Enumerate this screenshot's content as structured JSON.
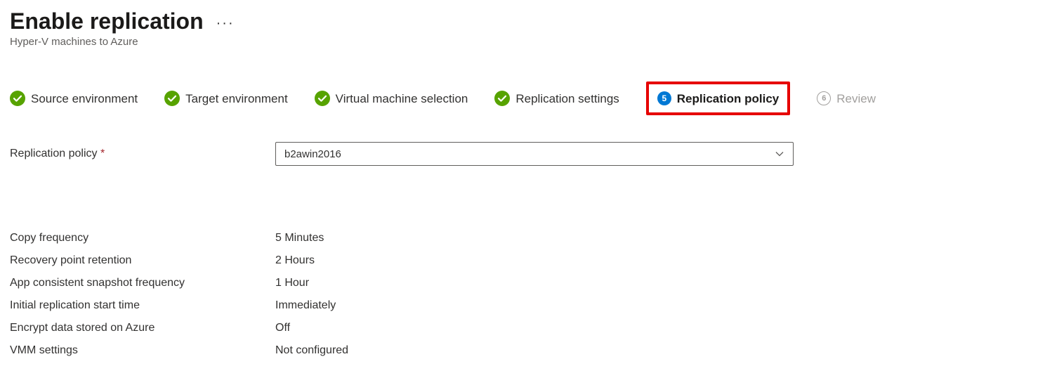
{
  "header": {
    "title": "Enable replication",
    "subtitle": "Hyper-V machines to Azure"
  },
  "steps": [
    {
      "label": "Source environment",
      "state": "completed"
    },
    {
      "label": "Target environment",
      "state": "completed"
    },
    {
      "label": "Virtual machine selection",
      "state": "completed"
    },
    {
      "label": "Replication settings",
      "state": "completed"
    },
    {
      "label": "Replication policy",
      "state": "current",
      "num": "5"
    },
    {
      "label": "Review",
      "state": "upcoming",
      "num": "6"
    }
  ],
  "form": {
    "policy_label": "Replication policy",
    "policy_value": "b2awin2016",
    "rows": [
      {
        "label": "Copy frequency",
        "value": "5 Minutes"
      },
      {
        "label": "Recovery point retention",
        "value": "2 Hours"
      },
      {
        "label": "App consistent snapshot frequency",
        "value": "1 Hour"
      },
      {
        "label": "Initial replication start time",
        "value": "Immediately"
      },
      {
        "label": "Encrypt data stored on Azure",
        "value": "Off"
      },
      {
        "label": "VMM settings",
        "value": "Not configured"
      }
    ]
  }
}
